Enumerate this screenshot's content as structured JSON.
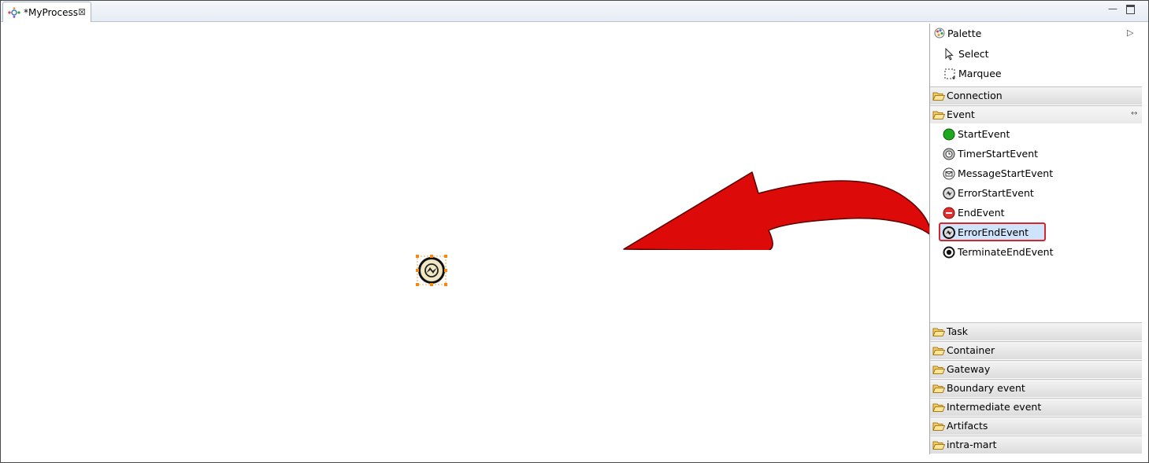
{
  "editor": {
    "tab_title": "*MyProcess",
    "tab_close_glyph": "⊠",
    "minimize_glyph": "—"
  },
  "palette": {
    "title": "Palette",
    "collapse_glyph": "▷",
    "tools": [
      {
        "label": "Select",
        "icon": "arrow-cursor-icon"
      },
      {
        "label": "Marquee",
        "icon": "marquee-icon"
      }
    ],
    "drawers": [
      {
        "label": "Connection",
        "open": false
      },
      {
        "label": "Event",
        "open": true,
        "pin_glyph": "↔"
      },
      {
        "label": "Task",
        "open": false
      },
      {
        "label": "Container",
        "open": false
      },
      {
        "label": "Gateway",
        "open": false
      },
      {
        "label": "Boundary event",
        "open": false
      },
      {
        "label": "Intermediate event",
        "open": false
      },
      {
        "label": "Artifacts",
        "open": false
      },
      {
        "label": "intra-mart",
        "open": false
      }
    ],
    "event_items": [
      {
        "label": "StartEvent",
        "icon": "start-event-icon"
      },
      {
        "label": "TimerStartEvent",
        "icon": "timer-start-event-icon"
      },
      {
        "label": "MessageStartEvent",
        "icon": "message-start-event-icon"
      },
      {
        "label": "ErrorStartEvent",
        "icon": "error-start-event-icon"
      },
      {
        "label": "EndEvent",
        "icon": "end-event-icon"
      },
      {
        "label": "ErrorEndEvent",
        "icon": "error-end-event-icon",
        "selected": true
      },
      {
        "label": "TerminateEndEvent",
        "icon": "terminate-end-event-icon"
      }
    ]
  },
  "colors": {
    "annotation_arrow": "#dd0a0a",
    "selection_highlight": "#cfe4fb",
    "selection_border": "#d1282e",
    "selection_handle": "#f08a12",
    "node_fill": "#efe6c2"
  }
}
